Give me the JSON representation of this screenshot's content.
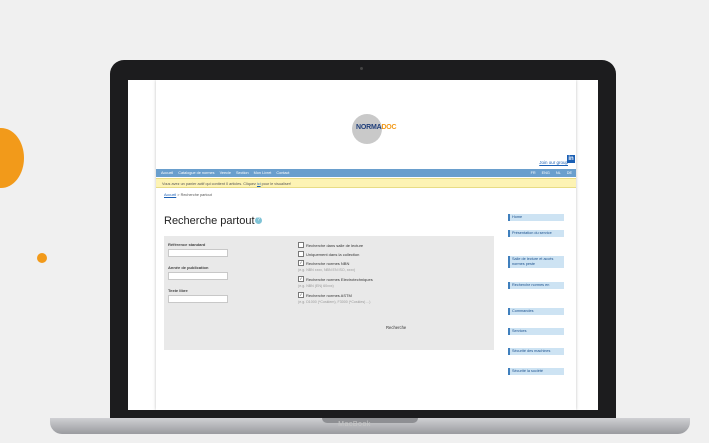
{
  "header": {
    "logo_main": "NORMA",
    "logo_accent": "DOC",
    "join_group": "Join our group",
    "linkedin": "in"
  },
  "nav": {
    "items": [
      "Accueil",
      "Catalogue de normes",
      "Veecle",
      "Section",
      "Mon Livret",
      "Contact"
    ],
    "languages": [
      "FR",
      "ENG",
      "NL",
      "DE"
    ]
  },
  "notice": {
    "text_before": "Vous avez un panier actif qui contient 0 articles. Cliquez ",
    "link": "ici",
    "text_after": " pour le visualiser!"
  },
  "breadcrumb": {
    "home": "Accueil",
    "current": " > Recherche partout"
  },
  "page": {
    "title": "Recherche partout",
    "help": "?"
  },
  "form": {
    "fields": [
      {
        "label": "Référence standard",
        "value": ""
      },
      {
        "label": "Année de publication",
        "value": ""
      },
      {
        "label": "Texte libre",
        "value": ""
      }
    ],
    "options": [
      {
        "label": "Recherche dans salle de lecture",
        "checked": false
      },
      {
        "label": "Uniquement dans la collection",
        "checked": false
      },
      {
        "label": "Recherche normes NBN",
        "checked": true,
        "hint": "(e.g. NBN xxxx, NBN EN ISO, xxxx)"
      },
      {
        "label": "Recherche normes Electrotechniques",
        "checked": true,
        "hint": "(e.g. NBN (EN) 60xxx)"
      },
      {
        "label": "Recherche normes ASTM",
        "checked": true,
        "hint": "(e.g. D1000 (*Cosklem), F3000 (*Coskles) ...)"
      }
    ],
    "search_button": "Recherche"
  },
  "sidebar": {
    "items": [
      "Home",
      "Présentation du service",
      "Salle de lecture et accès normes peste",
      "Recherche normes en",
      "Commandes",
      "Services",
      "Sécurité des machines",
      "Sécurité la société"
    ]
  },
  "device": {
    "brand": "MacBook"
  },
  "colors": {
    "accent_orange": "#f29a1a",
    "nav_blue": "#6a9fcd",
    "notice_yellow": "#fdf3b4",
    "link_blue": "#1a5fb4"
  }
}
